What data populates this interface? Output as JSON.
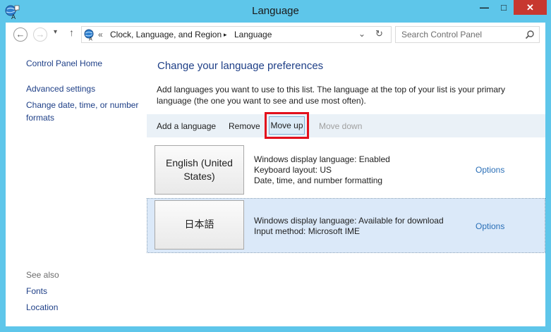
{
  "window": {
    "title": "Language",
    "min_glyph": "—",
    "max_glyph": "□",
    "close_glyph": "✕"
  },
  "nav": {
    "back_glyph": "←",
    "forward_glyph": "→",
    "recent_glyph": "▾",
    "up_glyph": "↑"
  },
  "address": {
    "overflow": "«",
    "crumbs": [
      "Clock, Language, and Region",
      "Language"
    ],
    "separator": "▸",
    "dropdown_glyph": "⌄",
    "refresh_glyph": "↻"
  },
  "search": {
    "placeholder": "Search Control Panel"
  },
  "sidebar": {
    "home": "Control Panel Home",
    "links": [
      "Advanced settings",
      "Change date, time, or number formats"
    ],
    "see_also_label": "See also",
    "see_also": [
      "Fonts",
      "Location"
    ]
  },
  "main": {
    "heading": "Change your language preferences",
    "description": "Add languages you want to use to this list. The language at the top of your list is your primary language (the one you want to see and use most often).",
    "toolbar": {
      "add": "Add a language",
      "remove": "Remove",
      "move_up": "Move up",
      "move_down": "Move down"
    },
    "languages": [
      {
        "name": "English (United States)",
        "details": [
          "Windows display language: Enabled",
          "Keyboard layout: US",
          "Date, time, and number formatting"
        ],
        "options": "Options",
        "selected": false
      },
      {
        "name": "日本語",
        "details": [
          "Windows display language: Available for download",
          "Input method: Microsoft IME"
        ],
        "options": "Options",
        "selected": true
      }
    ]
  },
  "colors": {
    "titlebar": "#5ec6ea",
    "close": "#c7382f",
    "link": "#1e3f87",
    "toolbar": "#eaf1f7",
    "selected_row": "#dbe9f9",
    "highlight_box": "#e3101c"
  }
}
